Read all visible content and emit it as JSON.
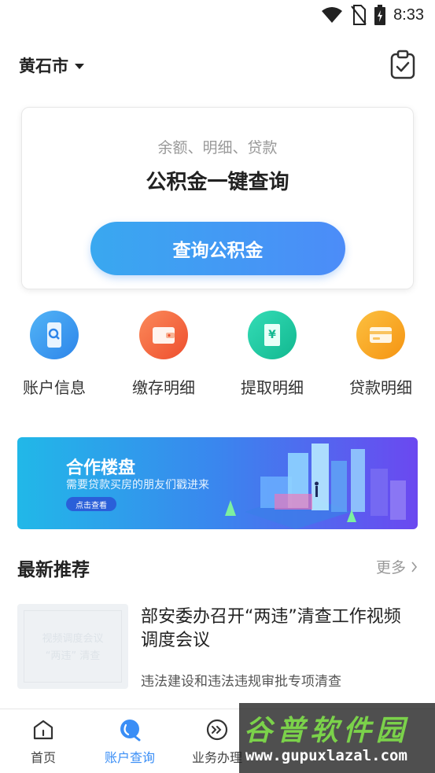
{
  "status_bar": {
    "time": "8:33"
  },
  "header": {
    "city": "黄石市"
  },
  "query_card": {
    "subtitle": "余额、明细、贷款",
    "title": "公积金一键查询",
    "button_label": "查询公积金"
  },
  "quick_actions": [
    {
      "label": "账户信息",
      "icon": "phone-search-icon",
      "color": "#3a9cf2"
    },
    {
      "label": "缴存明细",
      "icon": "wallet-icon",
      "color": "#f4663f"
    },
    {
      "label": "提取明细",
      "icon": "yuan-receipt-icon",
      "color": "#1ec8a2"
    },
    {
      "label": "贷款明细",
      "icon": "card-icon",
      "color": "#f7a21e"
    }
  ],
  "banner": {
    "title": "合作楼盘",
    "description": "需要贷款买房的朋友们戳进来",
    "button_label": "点击查看"
  },
  "recommend": {
    "title": "最新推荐",
    "more_label": "更多",
    "items": [
      {
        "title": "部安委办召开“两违”清查工作视频调度会议",
        "description": "违法建设和违法违规审批专项清查",
        "thumb_line1": "视频调度会议",
        "thumb_line2": "“两违” 清查"
      }
    ]
  },
  "bottom_nav": [
    {
      "label": "首页",
      "icon": "home-icon",
      "active": false
    },
    {
      "label": "账户查询",
      "icon": "account-query-icon",
      "active": true
    },
    {
      "label": "业务办理",
      "icon": "business-icon",
      "active": false
    }
  ],
  "watermark": {
    "logo": "谷普软件园",
    "url": "www.gupuxlazal.com"
  },
  "colors": {
    "accent": "#3a8ef6",
    "text": "#222222",
    "muted": "#999999"
  }
}
